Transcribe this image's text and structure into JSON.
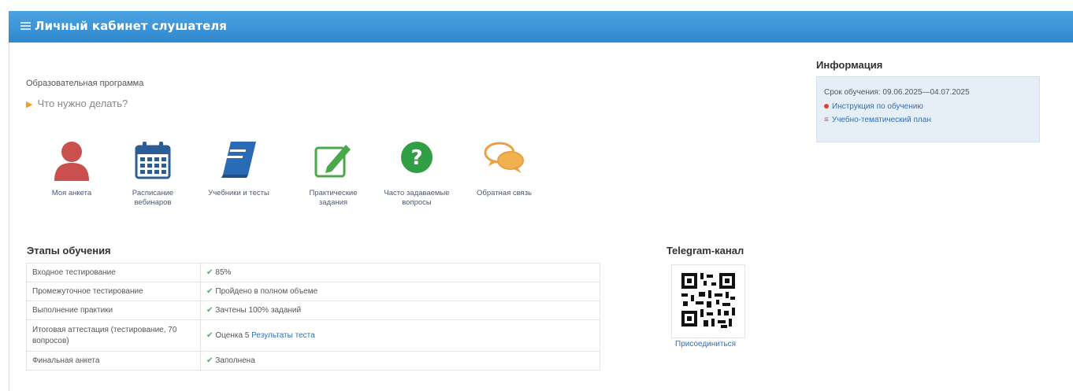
{
  "header": {
    "title": "Личный кабинет слушателя",
    "icon": "list-icon"
  },
  "program": {
    "label": "Образовательная программа",
    "todo": "Что нужно делать?"
  },
  "tiles": [
    {
      "label": "Моя анкета",
      "icon": "user-icon",
      "color": "#c9504f"
    },
    {
      "label": "Расписание вебинаров",
      "icon": "calendar-icon",
      "color": "#2d5d96"
    },
    {
      "label": "Учебники и тесты",
      "icon": "book-icon",
      "color": "#2a6bb5"
    },
    {
      "label": "Практические задания",
      "icon": "edit-icon",
      "color": "#4aa84a"
    },
    {
      "label": "Часто задаваемые вопросы",
      "icon": "question-icon",
      "color": "#2f9e45"
    },
    {
      "label": "Обратная связь",
      "icon": "chat-icon",
      "color": "#e8a040"
    }
  ],
  "stages": {
    "title": "Этапы обучения",
    "rows": [
      {
        "name": "Входное тестирование",
        "status": "85%",
        "link": ""
      },
      {
        "name": "Промежуточное тестирование",
        "status": "Пройдено в полном объеме",
        "link": ""
      },
      {
        "name": "Выполнение практики",
        "status": "Зачтены 100% заданий",
        "link": ""
      },
      {
        "name": "Итоговая аттестация (тестирование, 70 вопросов)",
        "status": "Оценка 5",
        "link": "Результаты теста"
      },
      {
        "name": "Финальная анкета",
        "status": "Заполнена",
        "link": ""
      }
    ]
  },
  "telegram": {
    "title": "Telegram-канал",
    "join": "Присоединиться"
  },
  "info": {
    "title": "Информация",
    "period": "Срок обучения: 09.06.2025—04.07.2025",
    "instructions": "Инструкция по обучению",
    "plan": "Учебно-тематический план"
  }
}
